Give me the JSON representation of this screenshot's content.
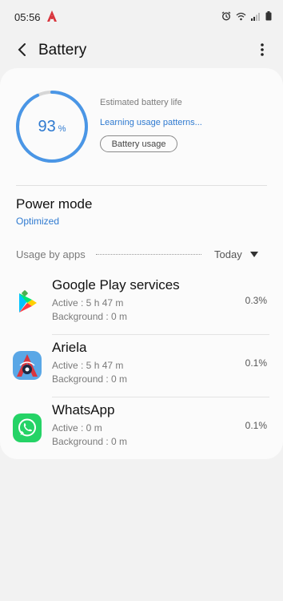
{
  "status_bar": {
    "time": "05:56"
  },
  "app_bar": {
    "title": "Battery"
  },
  "battery": {
    "percent": "93",
    "unit": "%",
    "level": 0.93,
    "estimated_label": "Estimated battery life",
    "learning_text": "Learning usage patterns...",
    "usage_button_label": "Battery usage"
  },
  "power_mode": {
    "title": "Power mode",
    "value": "Optimized"
  },
  "usage": {
    "label": "Usage by apps",
    "period": "Today",
    "apps": [
      {
        "name": "Google Play services",
        "active": "Active : 5 h 47 m",
        "background": "Background : 0 m",
        "percent": "0.3%",
        "icon": "google-play-services-icon"
      },
      {
        "name": "Ariela",
        "active": "Active : 5 h 47 m",
        "background": "Background : 0 m",
        "percent": "0.1%",
        "icon": "ariela-icon"
      },
      {
        "name": "WhatsApp",
        "active": "Active : 0 m",
        "background": "Background : 0 m",
        "percent": "0.1%",
        "icon": "whatsapp-icon"
      }
    ]
  },
  "colors": {
    "accent": "#2f7ad0",
    "ring_track": "#d6d6d6",
    "whatsapp": "#25d366",
    "ariela_bg": "#5aa7e6"
  }
}
